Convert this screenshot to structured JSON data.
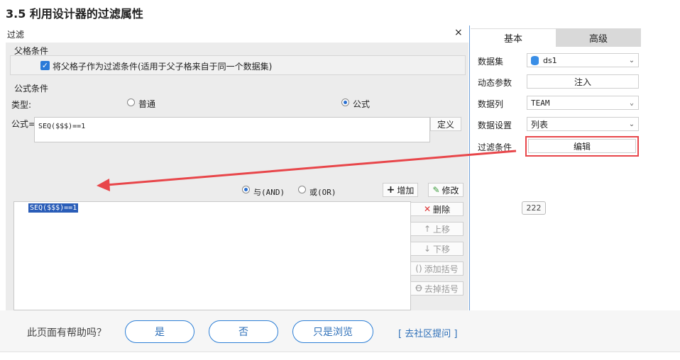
{
  "heading": "3.5 利用设计器的过滤属性",
  "dialog": {
    "title": "过滤",
    "close_glyph": "×",
    "parent_group": {
      "label": "父格条件",
      "checkbox_label": "将父格子作为过滤条件(适用于父子格来自于同一个数据集)",
      "checked": true
    },
    "formula_group": {
      "label": "公式条件",
      "type_label": "类型:",
      "opt_normal": "普通",
      "opt_formula": "公式",
      "selected": "公式",
      "formula_label": "公式=",
      "formula_value": "SEQ($$$)==1",
      "define_button": "定义"
    },
    "logic": {
      "and_label": "与(AND)",
      "or_label": "或(OR)",
      "selected": "与(AND)",
      "add_button": "增加",
      "edit_button": "修改"
    },
    "conditions": [
      "SEQ($$$)==1"
    ],
    "side_buttons": {
      "delete": "删除",
      "up": "上移",
      "down": "下移",
      "add_bracket": "添加括号",
      "remove_bracket": "去掉括号"
    }
  },
  "right_panel": {
    "tabs": [
      "基本",
      "高级"
    ],
    "active_tab": "基本",
    "rows": {
      "dataset": {
        "label": "数据集",
        "value": "ds1"
      },
      "dynamic_params": {
        "label": "动态参数",
        "value": "注入"
      },
      "data_column": {
        "label": "数据列",
        "value": "TEAM"
      },
      "data_setting": {
        "label": "数据设置",
        "value": "列表"
      },
      "filter": {
        "label": "过滤条件",
        "value": "编辑"
      }
    },
    "badge": "222"
  },
  "feedback": {
    "question": "此页面有帮助吗？",
    "yes": "是",
    "no": "否",
    "browse": "只是浏览",
    "community": "[ 去社区提问 ]"
  },
  "colors": {
    "accent_blue": "#2a7ad8",
    "highlight": "#2a5db8",
    "annotation_red": "#e8464a"
  }
}
